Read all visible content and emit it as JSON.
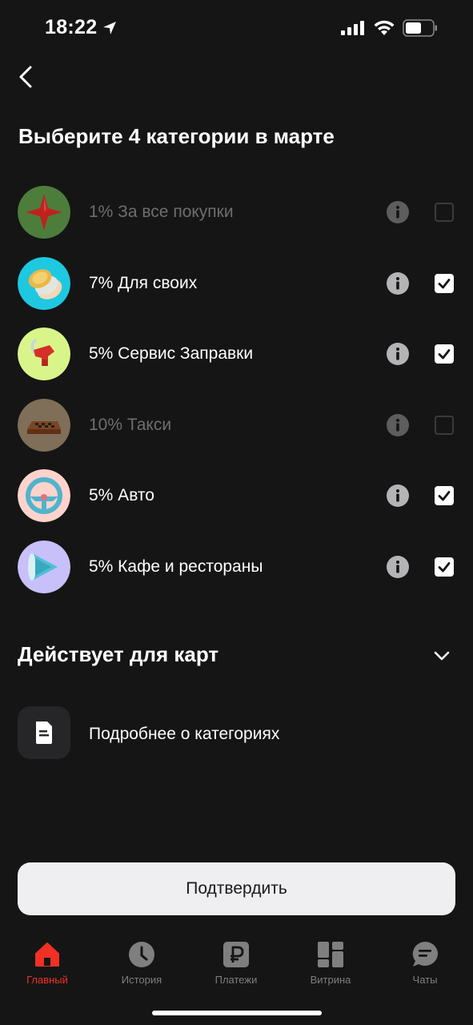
{
  "status_bar": {
    "time": "18:22"
  },
  "header": {
    "title": "Выберите 4 категории в марте"
  },
  "categories": [
    {
      "label": "1% За все покупки",
      "checked": false,
      "disabled": true,
      "icon": "star-icon"
    },
    {
      "label": "7% Для своих",
      "checked": true,
      "disabled": false,
      "icon": "coins-icon"
    },
    {
      "label": "5% Сервис Заправки",
      "checked": true,
      "disabled": false,
      "icon": "fuel-nozzle-icon"
    },
    {
      "label": "10% Такси",
      "checked": false,
      "disabled": true,
      "icon": "taxi-sign-icon"
    },
    {
      "label": "5% Авто",
      "checked": true,
      "disabled": false,
      "icon": "steering-wheel-icon"
    },
    {
      "label": "5% Кафе и рестораны",
      "checked": true,
      "disabled": false,
      "icon": "play-cone-icon"
    }
  ],
  "cards_section": {
    "title": "Действует для карт"
  },
  "more": {
    "label": "Подробнее о категориях"
  },
  "confirm": {
    "label": "Подтвердить"
  },
  "tabs": [
    {
      "label": "Главный",
      "icon": "home-icon",
      "active": true
    },
    {
      "label": "История",
      "icon": "clock-icon",
      "active": false
    },
    {
      "label": "Платежи",
      "icon": "ruble-icon",
      "active": false
    },
    {
      "label": "Витрина",
      "icon": "grid-icon",
      "active": false
    },
    {
      "label": "Чаты",
      "icon": "chat-icon",
      "active": false
    }
  ],
  "colors": {
    "background": "#151515",
    "accent": "#ef3124",
    "button": "#efeff1"
  }
}
